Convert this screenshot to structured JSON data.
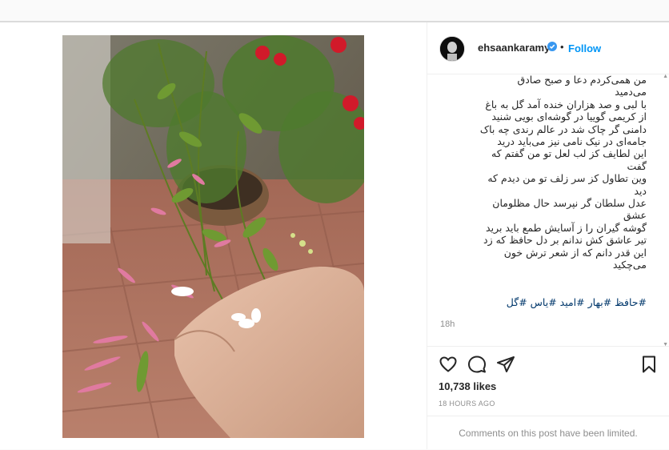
{
  "post": {
    "username": "ehsaankaramy",
    "follow_label": "Follow",
    "separator": "•",
    "caption_lines": [
      "من همی‌کردم دعا و صبح صادق",
      "می‌دمید",
      "با لبی و صد هزاران خنده آمد گل به باغ",
      "از کریمی گوییا در گوشه‌ای بویی شنید",
      "دامنی گر چاک شد در عالم رندی چه باک",
      "جامه‌ای در نیک نامی نیز می‌باید درید",
      "این لطایف کز لب لعل تو من گفتم که",
      "گفت",
      "وین تطاول کز سر زلف تو من دیدم که",
      "دید",
      "عدل سلطان گر نپرسد حال مظلومان",
      "عشق",
      "گوشه گیران را ز آسایش طمع باید برید",
      "تیر عاشق کش ندانم بر دل حافظ که زد",
      "این قدر دانم که از شعر ترش خون",
      "می‌چکید"
    ],
    "hashtags": "#حافظ #بهار #امید #یاس #گل",
    "caption_time": "18h",
    "likes": "10,738 likes",
    "time_ago": "18 HOURS AGO",
    "comments_notice": "Comments on this post have been limited."
  },
  "icons": {
    "like": "heart-icon",
    "comment": "comment-icon",
    "share": "share-icon",
    "save": "bookmark-icon",
    "verified": "verified-badge-icon"
  },
  "colors": {
    "link_blue": "#0095f6",
    "hashtag": "#00376b",
    "muted": "#8e8e8e"
  }
}
